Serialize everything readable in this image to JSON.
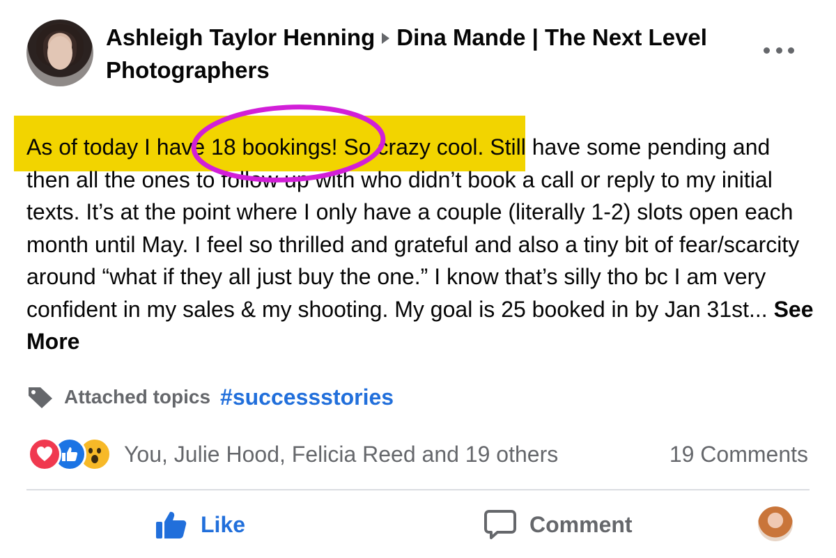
{
  "post": {
    "author": "Ashleigh Taylor Henning",
    "group": "Dina Mande | The Next Level Photographers",
    "body_highlighted": "As of today I have 18 bookings! So crazy cool.",
    "body_rest": " Still have some pending and then all the ones to follow up with who didn’t book a call or reply to my initial texts. It’s at the point where I only have a couple (literally 1-2) slots open each month until May. I feel so thrilled and grateful and also a tiny bit of fear/scarcity around “what if they all just buy the one.” I know that’s silly tho bc I am very confident in my sales & my shooting. My goal is 25 booked in by Jan 31st...",
    "see_more": "See More",
    "topics_label": "Attached topics",
    "topic": "#successstories"
  },
  "reactions": {
    "icons": [
      "love-icon",
      "like-icon",
      "wow-icon"
    ],
    "names": "You, Julie Hood, Felicia Reed and 19 others",
    "comments": "19 Comments"
  },
  "actions": {
    "like": "Like",
    "comment": "Comment"
  },
  "colors": {
    "highlight": "#f2d400",
    "annotation_circle": "#d21fd8",
    "link_blue": "#216fdb",
    "secondary_text": "#65676b"
  }
}
